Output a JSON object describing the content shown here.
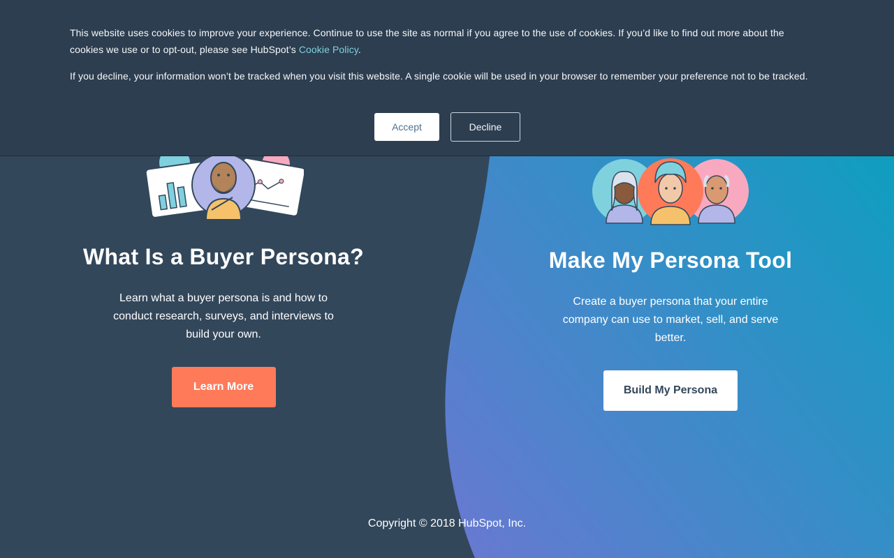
{
  "cookie_banner": {
    "text_1": "This website uses cookies to improve your experience. Continue to use the site as normal if you agree to the use of cookies. If you’d like to find out more about the cookies we use or to opt-out, please see HubSpot’s ",
    "policy_link": "Cookie Policy",
    "text_1_end": ".",
    "text_2": "If you decline, your information won’t be tracked when you visit this website. A single cookie will be used in your browser to remember your preference not to be tracked.",
    "accept_label": "Accept",
    "decline_label": "Decline"
  },
  "left_card": {
    "title": "What Is a Buyer Persona?",
    "description": "Learn what a buyer persona is and how to conduct research, surveys, and interviews to build your own.",
    "button_label": "Learn More",
    "illustration": "persona-with-charts-illustration"
  },
  "right_card": {
    "title": "Make My Persona Tool",
    "description": "Create a buyer persona that your entire company can use to market, sell, and serve better.",
    "button_label": "Build My Persona",
    "illustration": "three-personas-illustration"
  },
  "footer": {
    "copyright": "Copyright © 2018 HubSpot, Inc."
  },
  "colors": {
    "background": "#33475b",
    "banner": "#2d3e50",
    "accent_orange": "#ff7a59",
    "wave_gradient_start": "#6a78d1",
    "wave_gradient_end": "#00a4bd"
  }
}
